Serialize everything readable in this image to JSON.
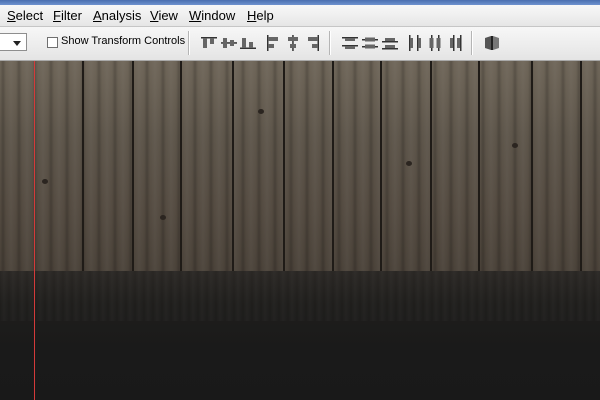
{
  "menu": {
    "items": [
      {
        "label": "Select"
      },
      {
        "label": "Filter"
      },
      {
        "label": "Analysis"
      },
      {
        "label": "View"
      },
      {
        "label": "Window"
      },
      {
        "label": "Help"
      }
    ]
  },
  "options_bar": {
    "show_transform_controls_label": "Show Transform Controls",
    "show_transform_controls_checked": false
  },
  "canvas": {
    "guide_color": "#d43a3a",
    "wall_color": "#5d554a",
    "floor_color": "#1a1a1a"
  }
}
